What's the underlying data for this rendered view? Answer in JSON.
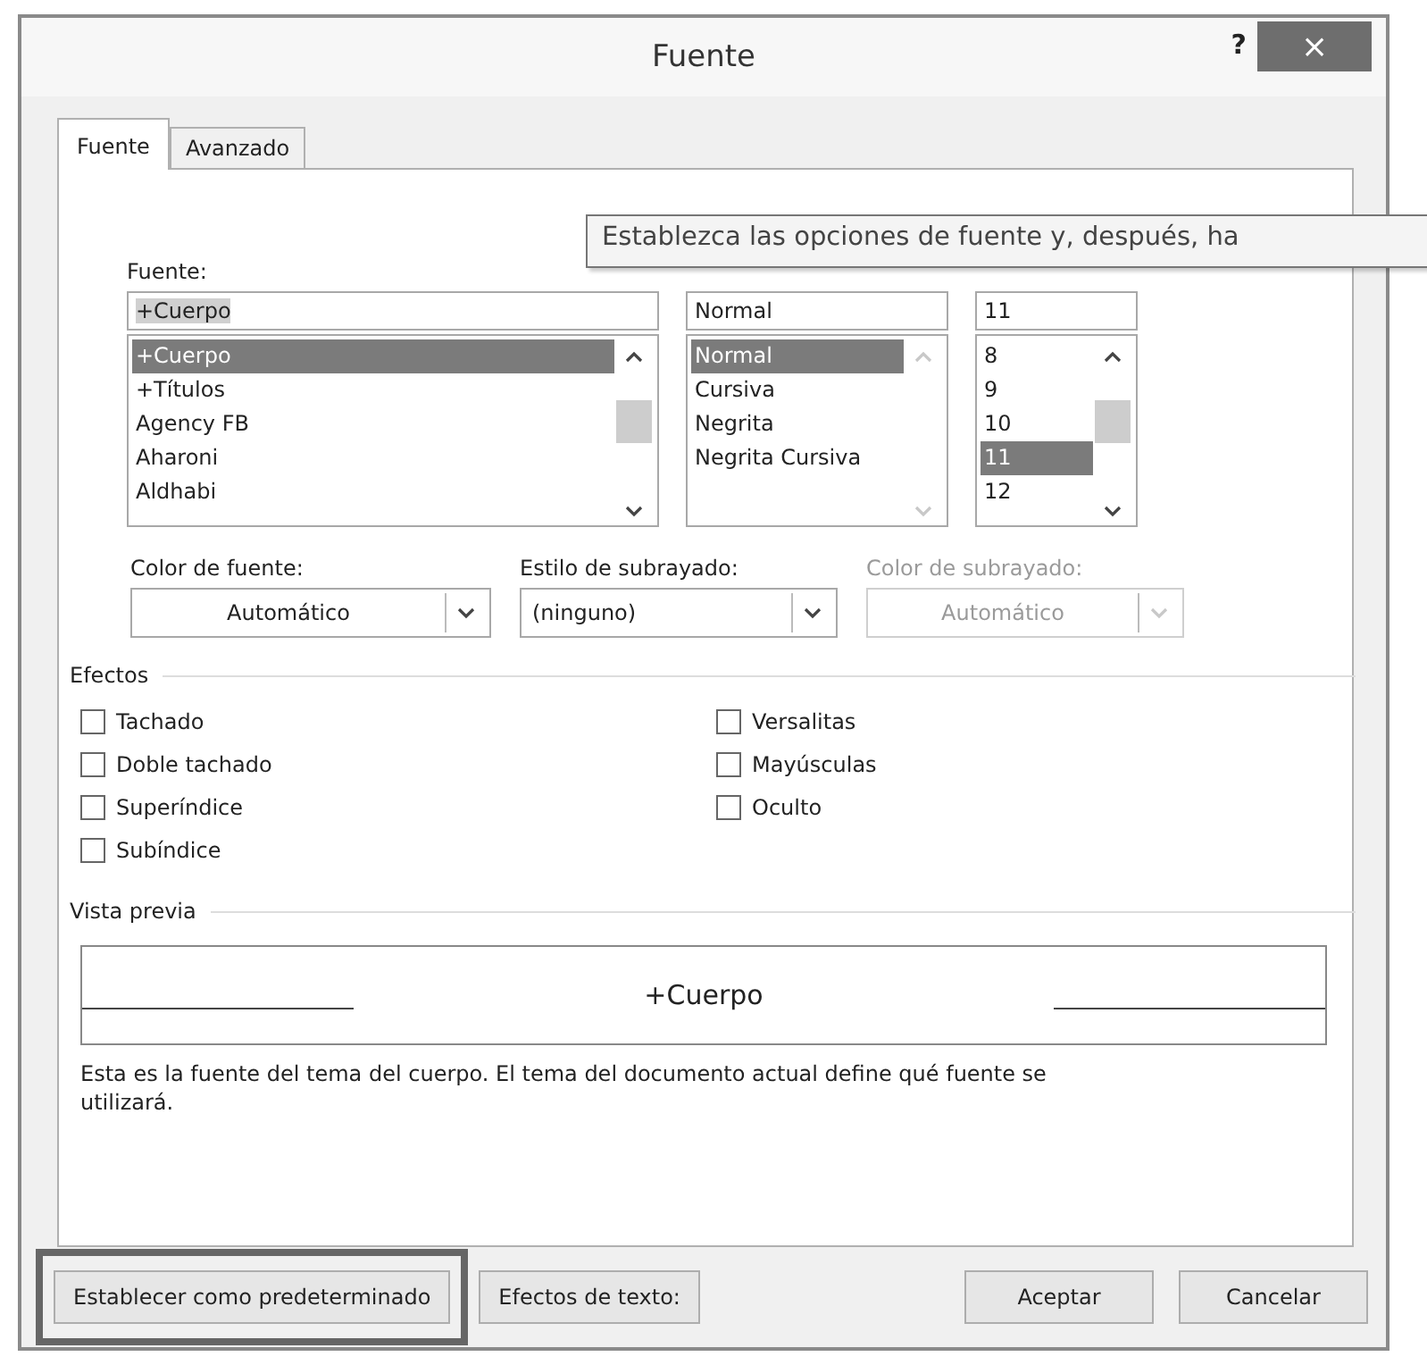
{
  "window": {
    "title": "Fuente",
    "help": "?",
    "close": "×"
  },
  "tabs": [
    {
      "label": "Fuente",
      "selected": true
    },
    {
      "label": "Avanzado",
      "selected": false
    }
  ],
  "tooltip": "Establezca las opciones de fuente y, después, ha",
  "font": {
    "label": "Fuente:",
    "value": "+Cuerpo",
    "scroll_disabled": false,
    "items": [
      {
        "label": "+Cuerpo",
        "selected": true
      },
      {
        "label": "+Títulos",
        "selected": false
      },
      {
        "label": "Agency FB",
        "selected": false
      },
      {
        "label": "Aharoni",
        "selected": false
      },
      {
        "label": "Aldhabi",
        "selected": false
      }
    ]
  },
  "style": {
    "value": "Normal",
    "scroll_disabled": true,
    "items": [
      {
        "label": "Normal",
        "selected": true
      },
      {
        "label": "Cursiva",
        "selected": false
      },
      {
        "label": "Negrita",
        "selected": false
      },
      {
        "label": "Negrita Cursiva",
        "selected": false
      }
    ]
  },
  "size": {
    "value": "11",
    "scroll_disabled": false,
    "items": [
      {
        "label": "8",
        "selected": false
      },
      {
        "label": "9",
        "selected": false
      },
      {
        "label": "10",
        "selected": false
      },
      {
        "label": "11",
        "selected": true
      },
      {
        "label": "12",
        "selected": false
      }
    ]
  },
  "dropdowns": [
    {
      "label": "Color de fuente:",
      "value": "Automático",
      "kind": "color",
      "disabled": false
    },
    {
      "label": "Estilo de subrayado:",
      "value": "(ninguno)",
      "kind": "list",
      "disabled": false
    },
    {
      "label": "Color de subrayado:",
      "value": "Automático",
      "kind": "color",
      "disabled": true
    }
  ],
  "effects": {
    "title": "Efectos",
    "columns": [
      [
        {
          "label": "Tachado",
          "checked": false
        },
        {
          "label": "Doble tachado",
          "checked": false
        },
        {
          "label": "Superíndice",
          "checked": false
        },
        {
          "label": "Subíndice",
          "checked": false
        }
      ],
      [
        {
          "label": "Versalitas",
          "checked": false
        },
        {
          "label": "Mayúsculas",
          "checked": false
        },
        {
          "label": "Oculto",
          "checked": false
        }
      ]
    ]
  },
  "preview": {
    "title": "Vista previa",
    "sample": "+Cuerpo",
    "description": "Esta es la fuente del tema del cuerpo. El tema del documento actual define qué fuente se utilizará."
  },
  "buttons": [
    {
      "label": "Establecer como predeterminado",
      "highlighted": true
    },
    {
      "label": "Efectos de texto:",
      "highlighted": false
    },
    {
      "label": "Aceptar",
      "highlighted": false
    },
    {
      "label": "Cancelar",
      "highlighted": false
    }
  ]
}
